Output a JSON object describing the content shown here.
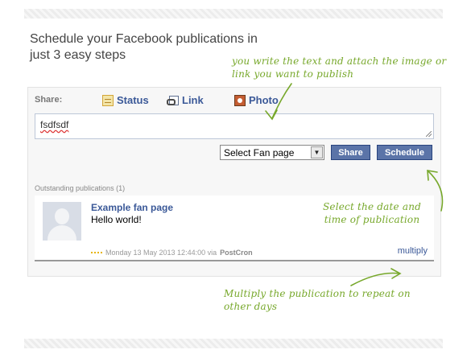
{
  "heading": "Schedule your Facebook publications in just 3 easy steps",
  "notes": {
    "step1": "you write the text and attach the image or link you want to publish",
    "step2": "Select the date and time of publication",
    "step3": "Multiply the publication to repeat on other days"
  },
  "share": {
    "label": "Share:",
    "tabs": [
      {
        "label": "Status",
        "icon": "status-icon"
      },
      {
        "label": "Link",
        "icon": "link-icon"
      },
      {
        "label": "Photo",
        "icon": "photo-icon"
      }
    ]
  },
  "composer": {
    "text": "fsdfsdf"
  },
  "controls": {
    "select_value": "Select Fan page",
    "share_button": "Share",
    "schedule_button": "Schedule"
  },
  "outstanding": {
    "label": "Outstanding publications (1)",
    "items": [
      {
        "page": "Example fan page",
        "text": "Hello world!",
        "date": "Monday 13 May 2013 12:44:00 via",
        "via": "PostCron",
        "action": "multiply"
      }
    ]
  },
  "colors": {
    "accent_green": "#77a82b",
    "facebook_blue": "#3b5998",
    "button_blue": "#5b74a8"
  }
}
